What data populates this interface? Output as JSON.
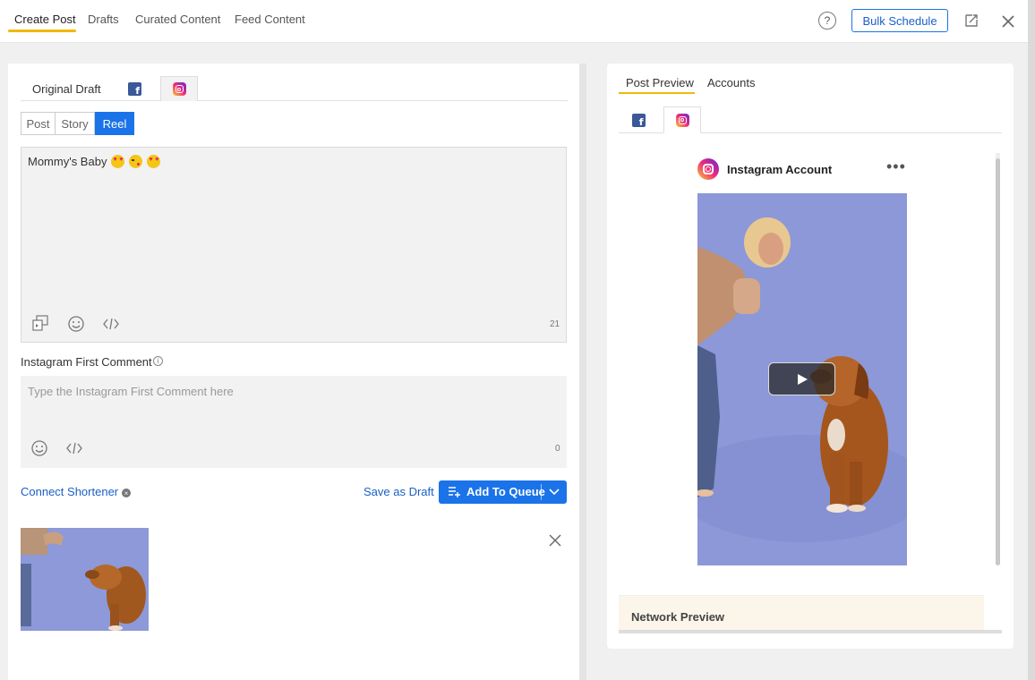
{
  "header": {
    "tabs": [
      {
        "label": "Create Post",
        "active": true
      },
      {
        "label": "Drafts",
        "active": false
      },
      {
        "label": "Curated Content",
        "active": false
      },
      {
        "label": "Feed Content",
        "active": false
      }
    ],
    "help_label": "?",
    "bulk_schedule_label": "Bulk Schedule"
  },
  "composer": {
    "draft_tabs": [
      {
        "label": "Original Draft",
        "icon": "text",
        "active": false
      },
      {
        "label": "",
        "icon": "facebook-icon",
        "active": false
      },
      {
        "label": "",
        "icon": "instagram-icon",
        "active": true
      }
    ],
    "post_types": [
      {
        "label": "Post",
        "active": false
      },
      {
        "label": "Story",
        "active": false
      },
      {
        "label": "Reel",
        "active": true
      }
    ],
    "message": "Mommy's Baby",
    "message_emojis": [
      "heart-eyes-emoji",
      "kiss-wink-emoji",
      "heart-eyes-emoji"
    ],
    "char_count": "21",
    "first_comment_label": "Instagram First Comment",
    "info_symbol": "i",
    "first_comment_placeholder": "Type the Instagram First Comment here",
    "first_comment_count": "0",
    "connect_shortener_label": "Connect Shortener",
    "save_draft_label": "Save as Draft",
    "add_queue_label": "Add To Queue"
  },
  "preview": {
    "tabs": [
      {
        "label": "Post Preview",
        "active": true
      },
      {
        "label": "Accounts",
        "active": false
      }
    ],
    "networks": [
      "facebook-icon",
      "instagram-icon"
    ],
    "account_name": "Instagram Account",
    "more_symbol": "•••",
    "network_preview_label": "Network Preview"
  },
  "colors": {
    "accent": "#1a73e8",
    "tab_underline": "#f0b90b",
    "facebook": "#3b5998"
  }
}
